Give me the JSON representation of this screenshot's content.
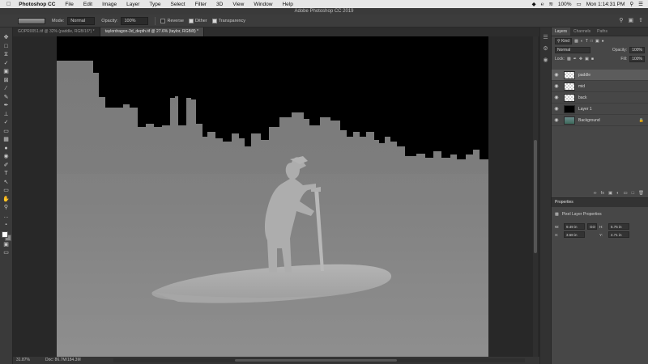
{
  "menubar": {
    "apple_icon": "apple-icon",
    "app_name": "Photoshop CC",
    "items": [
      "File",
      "Edit",
      "Image",
      "Layer",
      "Type",
      "Select",
      "Filter",
      "3D",
      "View",
      "Window",
      "Help"
    ],
    "battery": "100%",
    "clock": "Mon 1:14:31 PM"
  },
  "titlebar": {
    "title": "Adobe Photoshop CC 2019"
  },
  "options": {
    "mode_label": "Mode:",
    "mode_value": "Normal",
    "opacity_label": "Opacity:",
    "opacity_value": "100%",
    "reverse_label": "Reverse",
    "dither_label": "Dither",
    "transparency_label": "Transparency"
  },
  "tabs": [
    {
      "label": "GOPR0051.tif @ 32% (paddle, RGB/16*) *"
    },
    {
      "label": "taylordragon-3d_depth.tif @ 27.6% (taylor, RGB/8) *"
    }
  ],
  "status": {
    "zoom": "31.87%",
    "doc": "Doc: 86.7M/184.3M"
  },
  "layers_panel": {
    "tabs": [
      "Layers",
      "Channels",
      "Paths"
    ],
    "filter_value": "Kind",
    "blend_mode": "Normal",
    "opacity_label": "Opacity:",
    "opacity_value": "100%",
    "lock_label": "Lock:",
    "fill_label": "Fill:",
    "fill_value": "100%",
    "layers": [
      {
        "name": "paddle",
        "thumb": "checker",
        "selected": true
      },
      {
        "name": "mid",
        "thumb": "checker",
        "selected": false
      },
      {
        "name": "back",
        "thumb": "checker",
        "selected": false
      },
      {
        "name": "Layer 1",
        "thumb": "black",
        "selected": false
      },
      {
        "name": "Background",
        "thumb": "photo",
        "selected": false,
        "locked": true
      }
    ]
  },
  "properties_panel": {
    "title": "Properties",
    "subtitle": "Pixel Layer Properties",
    "w_label": "W:",
    "w_value": "9.49 in",
    "go_label": "GO",
    "h_label": "H:",
    "h_value": "5.75 in",
    "x_label": "X:",
    "x_value": "3.68 in",
    "y_label": "Y:",
    "y_value": "4.71 in"
  }
}
